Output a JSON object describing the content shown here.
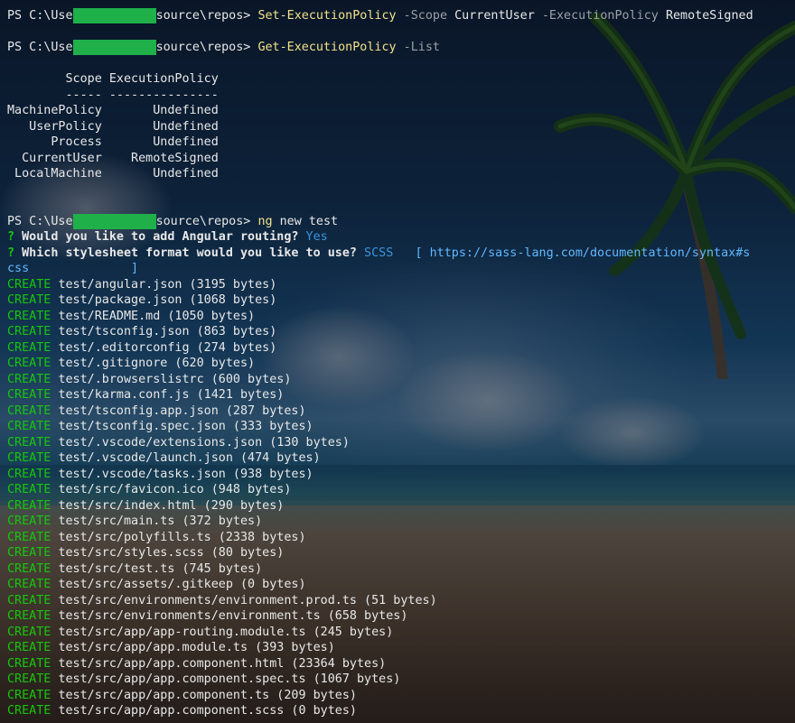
{
  "terminal": {
    "prompt_prefix": "PS C:\\Use",
    "prompt_suffix": "source\\repos>",
    "commands": [
      {
        "cmd": "Set-ExecutionPolicy",
        "parts": [
          {
            "text": " -Scope ",
            "cls": "g"
          },
          {
            "text": "CurrentUser",
            "cls": "w"
          },
          {
            "text": " -ExecutionPolicy ",
            "cls": "g"
          },
          {
            "text": "RemoteSigned",
            "cls": "w"
          }
        ]
      },
      {
        "cmd": "Get-ExecutionPolicy",
        "parts": [
          {
            "text": " -List",
            "cls": "g"
          }
        ]
      }
    ],
    "policy_table": {
      "header": "        Scope ExecutionPolicy",
      "rule": "        ----- ---------------",
      "rows": [
        "MachinePolicy       Undefined",
        "   UserPolicy       Undefined",
        "      Process       Undefined",
        "  CurrentUser    RemoteSigned",
        " LocalMachine       Undefined"
      ]
    },
    "ng_command": {
      "cmd": "ng",
      "args": " new test"
    },
    "questions": [
      {
        "mark": "?",
        "text": " Would you like to add Angular routing? ",
        "answer": "Yes",
        "extra": ""
      },
      {
        "mark": "?",
        "text": " Which stylesheet format would you like to use? ",
        "answer": "SCSS",
        "extra": "   [ https://sass-lang.com/documentation/syntax#s"
      }
    ],
    "wrap_line": "css              ]",
    "create_label": "CREATE",
    "created_files": [
      "test/angular.json (3195 bytes)",
      "test/package.json (1068 bytes)",
      "test/README.md (1050 bytes)",
      "test/tsconfig.json (863 bytes)",
      "test/.editorconfig (274 bytes)",
      "test/.gitignore (620 bytes)",
      "test/.browserslistrc (600 bytes)",
      "test/karma.conf.js (1421 bytes)",
      "test/tsconfig.app.json (287 bytes)",
      "test/tsconfig.spec.json (333 bytes)",
      "test/.vscode/extensions.json (130 bytes)",
      "test/.vscode/launch.json (474 bytes)",
      "test/.vscode/tasks.json (938 bytes)",
      "test/src/favicon.ico (948 bytes)",
      "test/src/index.html (290 bytes)",
      "test/src/main.ts (372 bytes)",
      "test/src/polyfills.ts (2338 bytes)",
      "test/src/styles.scss (80 bytes)",
      "test/src/test.ts (745 bytes)",
      "test/src/assets/.gitkeep (0 bytes)",
      "test/src/environments/environment.prod.ts (51 bytes)",
      "test/src/environments/environment.ts (658 bytes)",
      "test/src/app/app-routing.module.ts (245 bytes)",
      "test/src/app/app.module.ts (393 bytes)",
      "test/src/app/app.component.html (23364 bytes)",
      "test/src/app/app.component.spec.ts (1067 bytes)",
      "test/src/app/app.component.ts (209 bytes)",
      "test/src/app/app.component.scss (0 bytes)"
    ]
  },
  "colors": {
    "command": "#f2e28a",
    "parameter": "#9aa0a6",
    "create": "#16c60c",
    "answer": "#3a96dd",
    "redaction": "#1fb04a"
  }
}
